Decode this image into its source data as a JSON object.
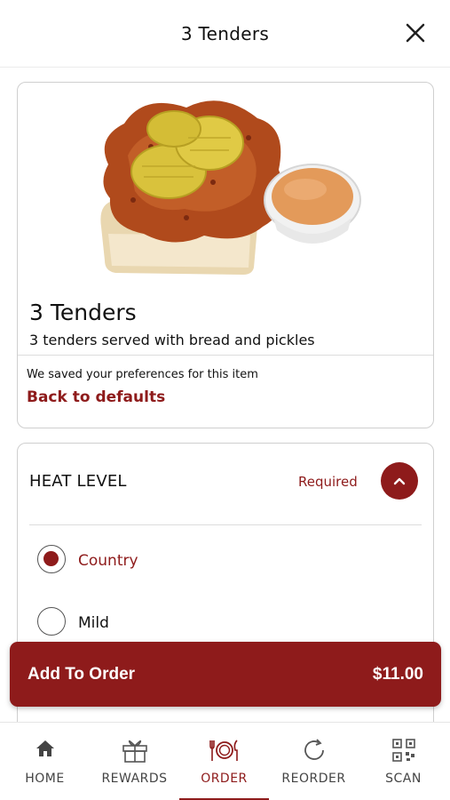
{
  "header": {
    "title": "3 Tenders",
    "close_icon": "close-icon"
  },
  "item": {
    "image_icon": "food-photo",
    "name": "3 Tenders",
    "description": "3 tenders served with bread and pickles",
    "saved_note": "We saved your preferences for this item",
    "defaults_link": "Back to defaults"
  },
  "heat_level": {
    "title": "HEAT LEVEL",
    "required_label": "Required",
    "collapse_icon": "chevron-up-icon",
    "options": [
      {
        "label": "Country",
        "selected": true
      },
      {
        "label": "Mild",
        "selected": false
      }
    ]
  },
  "add_to_order": {
    "label": "Add To Order",
    "price": "$11.00"
  },
  "tabbar": {
    "active": "ORDER",
    "tabs": [
      {
        "label": "HOME",
        "icon": "home-icon"
      },
      {
        "label": "REWARDS",
        "icon": "gift-icon"
      },
      {
        "label": "ORDER",
        "icon": "plate-utensils-icon"
      },
      {
        "label": "REORDER",
        "icon": "reorder-icon"
      },
      {
        "label": "SCAN",
        "icon": "qr-code-icon"
      }
    ]
  },
  "colors": {
    "accent": "#8e1b1b",
    "border": "#cfcfcf",
    "text": "#111111"
  }
}
